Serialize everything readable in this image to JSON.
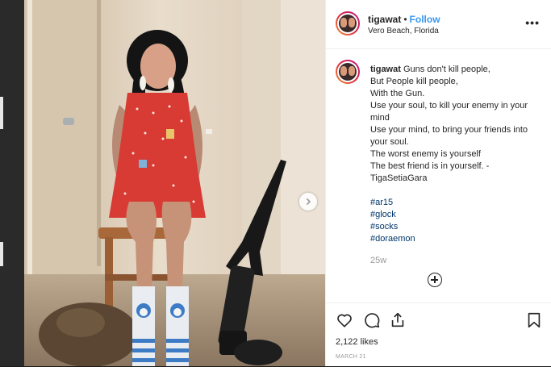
{
  "post": {
    "username": "tigawat",
    "follow_label": "Follow",
    "separator": "•",
    "location": "Vero Beach, Florida",
    "more_label": "•••"
  },
  "caption": {
    "username": "tigawat",
    "lines": [
      "Guns don't kill people,",
      "But People kill people,",
      "With the Gun.",
      "Use your soul, to kill your enemy in your mind",
      "Use your mind, to bring your friends into your soul.",
      "The worst enemy is yourself",
      "The best friend is in yourself. - TigaSetiaGara"
    ],
    "hashtags": [
      "#ar15",
      "#glock",
      "#socks",
      "#doraemon"
    ],
    "age": "25w"
  },
  "footer": {
    "likes": "2,122 likes",
    "date": "MARCH 21"
  },
  "icons": {
    "like": "heart-icon",
    "comment": "comment-icon",
    "share": "share-icon",
    "save": "bookmark-icon",
    "load_more": "plus-circle-icon",
    "next": "chevron-right-icon"
  },
  "colors": {
    "link": "#3897f0",
    "hashtag": "#003569",
    "muted": "#999999",
    "text": "#262626"
  }
}
